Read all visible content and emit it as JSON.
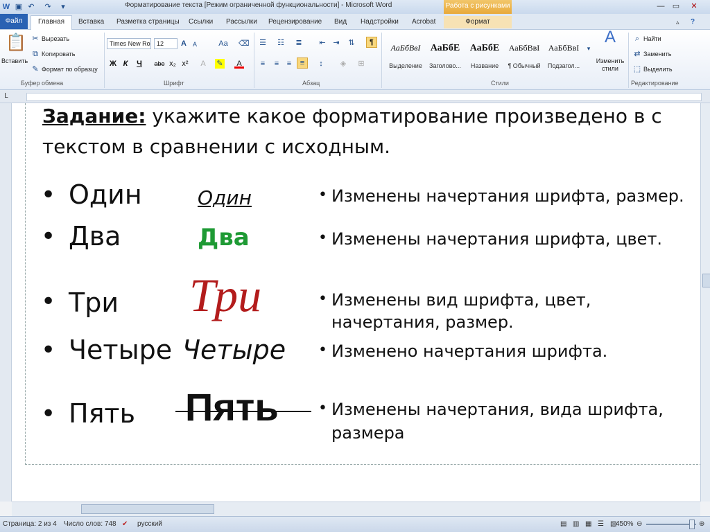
{
  "window": {
    "title": "Форматирование текста [Режим ограниченной функциональности] - Microsoft Word",
    "context_tab_title": "Работа с рисунками"
  },
  "tabs": [
    "Файл",
    "Главная",
    "Вставка",
    "Разметка страницы",
    "Ссылки",
    "Рассылки",
    "Рецензирование",
    "Вид",
    "Надстройки",
    "Acrobat",
    "Формат"
  ],
  "ribbon": {
    "clipboard": {
      "paste": "Вставить",
      "cut": "Вырезать",
      "copy": "Копировать",
      "format_painter": "Формат по образцу",
      "label": "Буфер обмена"
    },
    "font": {
      "name": "Times New Ro",
      "size": "12",
      "label": "Шрифт",
      "bold": "Ж",
      "italic": "К",
      "underline": "Ч",
      "strike": "abe",
      "sub": "x₂",
      "sup": "x²",
      "grow": "A",
      "shrink": "A",
      "case": "Aa"
    },
    "paragraph": {
      "label": "Абзац",
      "show_marks": "¶"
    },
    "styles": {
      "label": "Стили",
      "items": [
        {
          "preview": "АаБбВвI",
          "name": "Выделение"
        },
        {
          "preview": "АаБбЕ",
          "name": "Заголово..."
        },
        {
          "preview": "АаБбЕ",
          "name": "Название"
        },
        {
          "preview": "АаБбВвI",
          "name": "¶ Обычный"
        },
        {
          "preview": "АаБбВвI",
          "name": "Подзагол..."
        }
      ],
      "change_styles": "Изменить стили"
    },
    "editing": {
      "label": "Редактирование",
      "find": "Найти",
      "replace": "Заменить",
      "select": "Выделить"
    }
  },
  "document": {
    "task_label": "Задание:",
    "task_text_line1": " укажите какое форматирование произведено в с",
    "task_text_line2": "текстом в сравнении с исходным.",
    "rows": [
      {
        "original": "Один",
        "formatted": "Один",
        "answer": "Изменены начертания шрифта, размер."
      },
      {
        "original": "Два",
        "formatted": "Два",
        "answer": "Изменены начертания шрифта, цвет."
      },
      {
        "original": "Три",
        "formatted": "Три",
        "answer": "Изменены вид шрифта, цвет,",
        "answer2": "начертания, размер."
      },
      {
        "original": "Четыре",
        "formatted": "Четыре",
        "answer": "Изменено начертания шрифта."
      },
      {
        "original": "Пять",
        "formatted": "Пять",
        "answer": "Изменены начертания, вида шрифта,",
        "answer2": "размера"
      }
    ],
    "colors": {
      "green": "#1e9a34",
      "red": "#b31c1c"
    }
  },
  "status": {
    "page": "Страница: 2 из 4",
    "words": "Число слов: 748",
    "lang": "русский",
    "zoom": "450%"
  }
}
